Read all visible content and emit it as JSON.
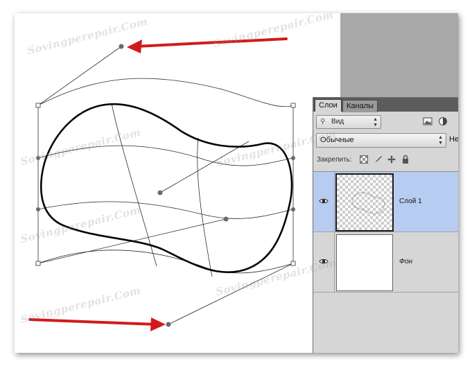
{
  "panel": {
    "tabs": [
      {
        "label": "Слои"
      },
      {
        "label": "Каналы"
      }
    ],
    "kind_filter": {
      "value": "Вид",
      "icon": "search-icon"
    },
    "blend_mode": {
      "value": "Обычные"
    },
    "opacity_label_cut": "Не",
    "lock": {
      "label": "Закрепить:",
      "icons": [
        "lock-transparent-pixels-icon",
        "lock-image-pixels-icon",
        "lock-position-icon",
        "lock-all-icon"
      ]
    },
    "layers": [
      {
        "name": "Слой 1",
        "selected": true,
        "visible": true
      },
      {
        "name": "Фон",
        "selected": false,
        "visible": true
      }
    ]
  },
  "watermark_text": "Sovingperepair.Com",
  "colors": {
    "arrow": "#d21a1a",
    "selection": "#b7ccf1",
    "panel_bg": "#d6d6d6",
    "tab_bar": "#5c5c5c"
  }
}
